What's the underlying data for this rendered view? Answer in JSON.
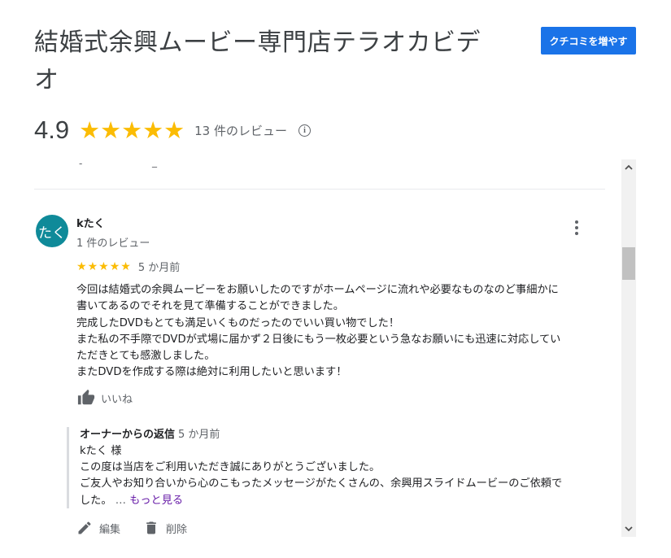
{
  "business": {
    "title": "結婚式余興ムービー専門店テラオカビデオ",
    "add_review_label": "クチコミを増やす"
  },
  "summary": {
    "rating": "4.9",
    "stars": 5,
    "review_count": "13 件のレビュー"
  },
  "review": {
    "avatar_text": "たく",
    "avatar_color": "#0f8a99",
    "reviewer_name": "kたく",
    "reviewer_meta": "1 件のレビュー",
    "stars": 5,
    "date": "5 か月前",
    "text_lines": [
      "今回は結婚式の余興ムービーをお願いしたのですがホームページに流れや必要なものなのど事細かに",
      "書いてあるのでそれを見て準備することができました。",
      "完成したDVDもとても満足いくものだったのでいい買い物でした！",
      "また私の不手際でDVDが式場に届かず２日後にもう一枚必要という急なお願いにも迅速に対応してい",
      "ただきとても感激しました。",
      "またDVDを作成する際は絶対に利用したいと思います！"
    ],
    "like_label": "いいね",
    "owner_reply": {
      "label": "オーナーからの返信",
      "date": "5 か月前",
      "lines": [
        "kたく 様",
        "この度は当店をご利用いただき誠にありがとうございました。",
        "ご友人やお知り合いから心のこもったメッセージがたくさんの、余興用スライドムービーのご依頼で",
        "した。"
      ],
      "ellipsis": "…",
      "more_label": "もっと見る"
    },
    "edit_label": "編集",
    "delete_label": "削除"
  },
  "colors": {
    "accent": "#1a73e8",
    "star": "#fbbc04",
    "link": "#681da8"
  }
}
